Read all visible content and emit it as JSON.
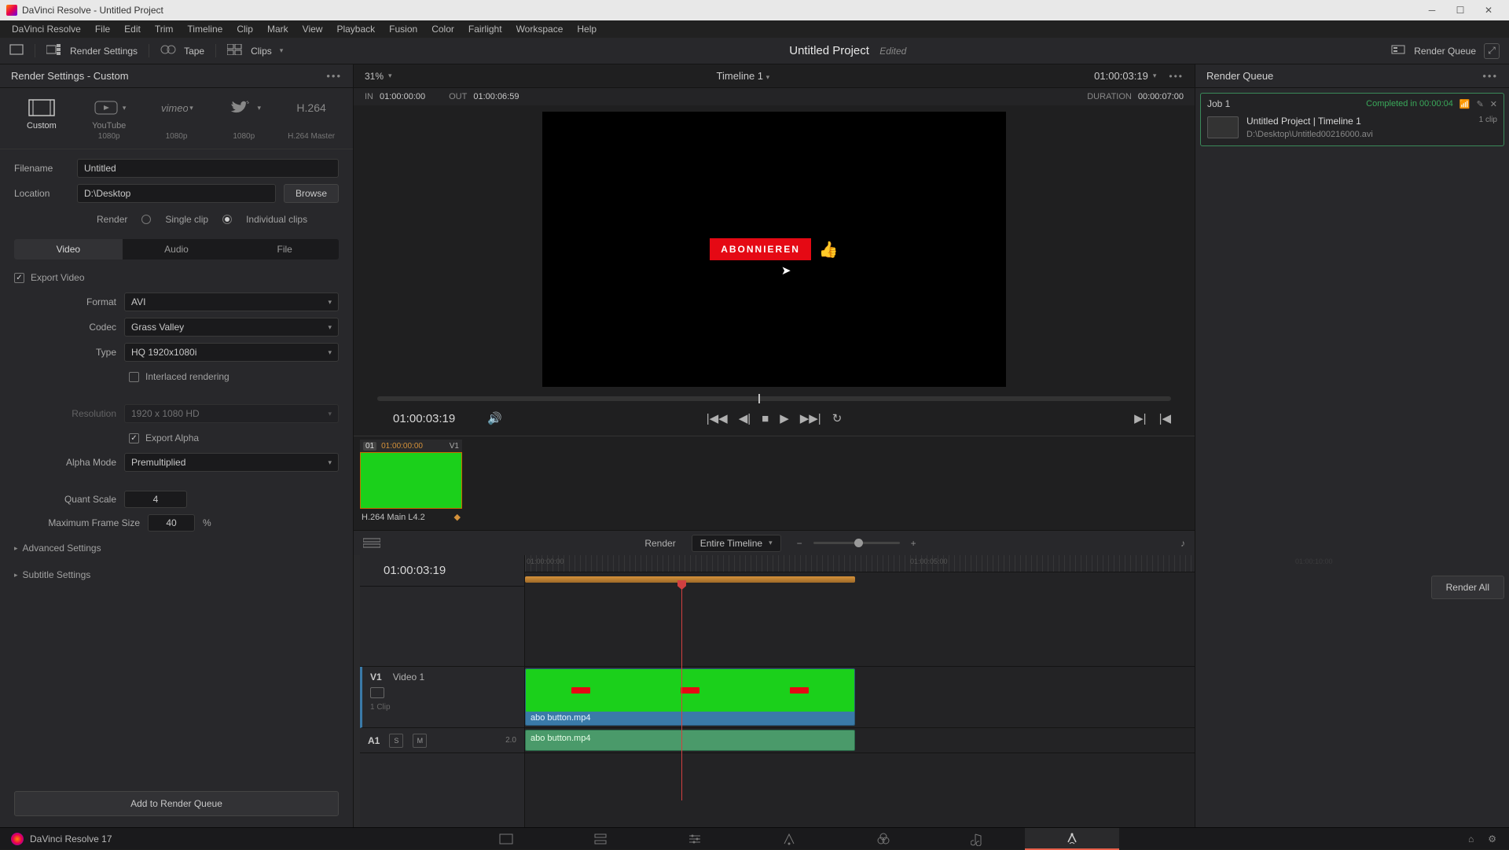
{
  "window": {
    "title": "DaVinci Resolve - Untitled Project"
  },
  "menu": [
    "DaVinci Resolve",
    "File",
    "Edit",
    "Trim",
    "Timeline",
    "Clip",
    "Mark",
    "View",
    "Playback",
    "Fusion",
    "Color",
    "Fairlight",
    "Workspace",
    "Help"
  ],
  "toolbar": {
    "render_settings": "Render Settings",
    "tape": "Tape",
    "clips": "Clips",
    "project_title": "Untitled Project",
    "edited": "Edited",
    "render_queue": "Render Queue"
  },
  "left": {
    "header": "Render Settings - Custom",
    "presets": [
      {
        "name": "Custom",
        "sub": "",
        "active": true
      },
      {
        "name": "YouTube",
        "sub": "1080p"
      },
      {
        "name": "Vimeo",
        "sub": "1080p"
      },
      {
        "name": "Twitter",
        "sub": "1080p"
      },
      {
        "name": "H.264",
        "sub": "H.264 Master"
      }
    ],
    "filename_label": "Filename",
    "filename_value": "Untitled",
    "location_label": "Location",
    "location_value": "D:\\Desktop",
    "browse": "Browse",
    "render_label": "Render",
    "single_clip": "Single clip",
    "individual_clips": "Individual clips",
    "tabs": [
      "Video",
      "Audio",
      "File"
    ],
    "export_video": "Export Video",
    "format_label": "Format",
    "format_value": "AVI",
    "codec_label": "Codec",
    "codec_value": "Grass Valley",
    "type_label": "Type",
    "type_value": "HQ 1920x1080i",
    "interlaced": "Interlaced rendering",
    "resolution_label": "Resolution",
    "resolution_value": "1920 x 1080 HD",
    "export_alpha": "Export Alpha",
    "alpha_mode_label": "Alpha Mode",
    "alpha_mode_value": "Premultiplied",
    "quant_label": "Quant Scale",
    "quant_value": "4",
    "maxframe_label": "Maximum Frame Size",
    "maxframe_value": "40",
    "maxframe_unit": "%",
    "advanced": "Advanced Settings",
    "subtitle": "Subtitle Settings",
    "add_queue": "Add to Render Queue"
  },
  "center": {
    "zoom": "31%",
    "timeline_name": "Timeline 1",
    "playhead_tc": "01:00:03:19",
    "in_label": "IN",
    "in_value": "01:00:00:00",
    "out_label": "OUT",
    "out_value": "01:00:06:59",
    "duration_label": "DURATION",
    "duration_value": "00:00:07:00",
    "viewer_button": "ABONNIEREN",
    "transport_tc": "01:00:03:19",
    "clip_idx": "01",
    "clip_tc": "01:00:00:00",
    "clip_track": "V1",
    "clip_codec": "H.264 Main L4.2",
    "tl_render_label": "Render",
    "tl_range": "Entire Timeline",
    "tl_tc": "01:00:03:19",
    "ruler_tc1": "01:00:00:00",
    "ruler_tc2": "01:00:05:00",
    "ruler_tc3": "01:00:10:00",
    "track_v1": "V1",
    "track_v1_name": "Video 1",
    "track_v1_clips": "1 Clip",
    "track_a1": "A1",
    "track_a1_level": "2.0",
    "clip_filename": "abo button.mp4"
  },
  "right": {
    "header": "Render Queue",
    "job_id": "Job 1",
    "job_status": "Completed in 00:00:04",
    "job_title": "Untitled Project | Timeline 1",
    "job_clips": "1 clip",
    "job_path": "D:\\Desktop\\Untitled00216000.avi",
    "render_all": "Render All"
  },
  "footer": {
    "version": "DaVinci Resolve 17"
  }
}
